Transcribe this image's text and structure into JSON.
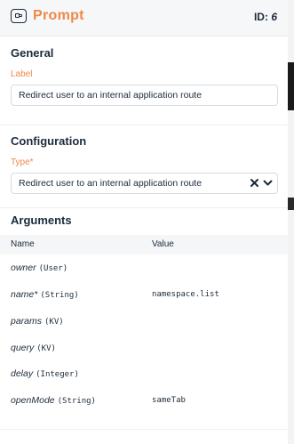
{
  "header": {
    "title": "Prompt",
    "id_label": "ID:",
    "id_value": "6",
    "icon": "prompt-icon"
  },
  "general": {
    "title": "General",
    "label_field_label": "Label",
    "label_value": "Redirect user to an internal application route"
  },
  "configuration": {
    "title": "Configuration",
    "type_label": "Type*",
    "type_value": "Redirect user to an internal application route",
    "clear_icon": "close-icon",
    "chevron_icon": "chevron-down-icon"
  },
  "arguments": {
    "title": "Arguments",
    "columns": {
      "name": "Name",
      "value": "Value"
    },
    "rows": [
      {
        "name": "owner",
        "type": "(User)",
        "value": ""
      },
      {
        "name": "name*",
        "type": "(String)",
        "value": "namespace.list"
      },
      {
        "name": "params",
        "type": "(KV)",
        "value": ""
      },
      {
        "name": "query",
        "type": "(KV)",
        "value": ""
      },
      {
        "name": "delay",
        "type": "(Integer)",
        "value": ""
      },
      {
        "name": "openMode",
        "type": "(String)",
        "value": "sameTab"
      }
    ]
  },
  "colors": {
    "accent": "#f08848",
    "text": "#1c2b3a",
    "header_bg": "#f6f7f8",
    "table_header_bg": "#f4f6f8"
  }
}
